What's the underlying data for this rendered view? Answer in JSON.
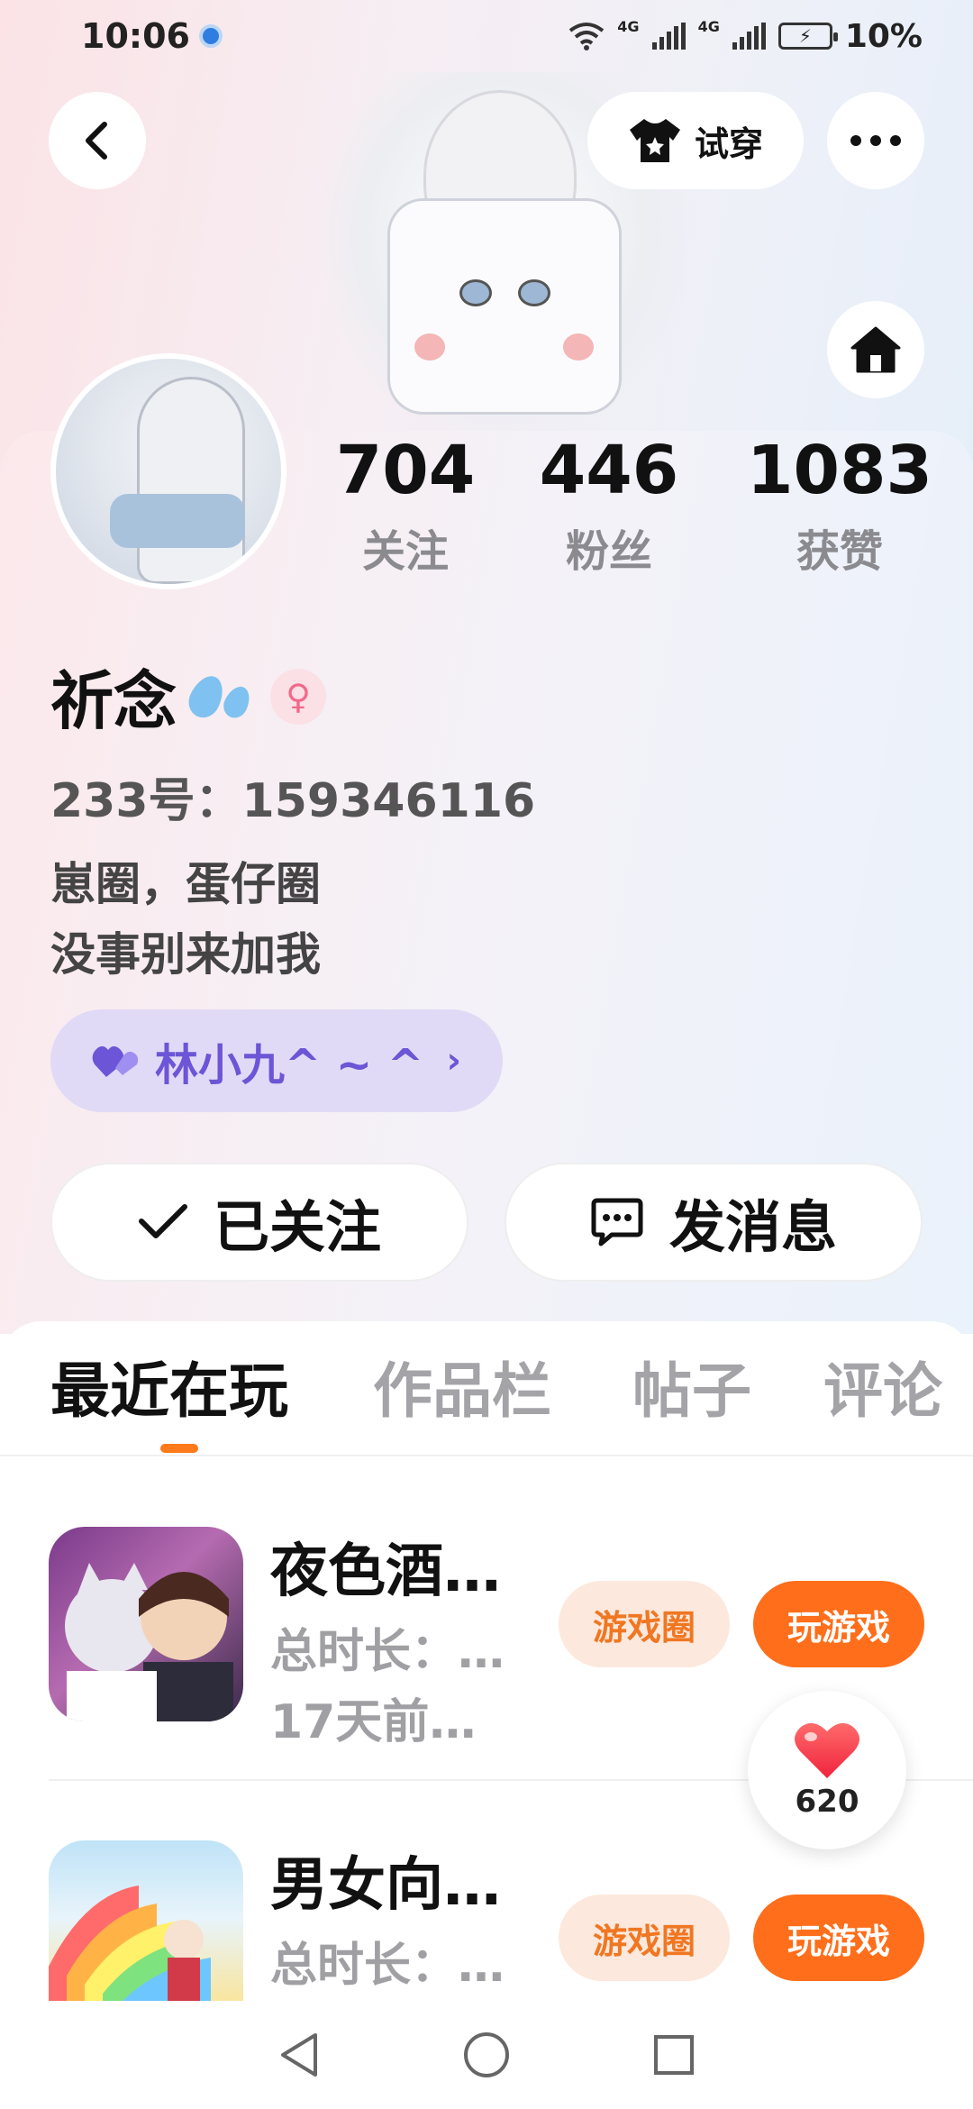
{
  "status_bar": {
    "time": "10:06",
    "network_left": "4G",
    "network_right": "4G",
    "battery": "10%"
  },
  "header": {
    "try_on_label": "试穿"
  },
  "profile": {
    "stats": [
      {
        "value": "704",
        "label": "关注"
      },
      {
        "value": "446",
        "label": "粉丝"
      },
      {
        "value": "1083",
        "label": "获赞"
      }
    ],
    "name": "祈念",
    "gender_symbol": "♀",
    "id_text": "233号：159346116",
    "bio_line1": "崽圈，蛋仔圈",
    "bio_line2": "没事别来加我",
    "friend_name": "林小九^ ~ ^",
    "follow_label": "已关注",
    "message_label": "发消息"
  },
  "tabs": [
    "最近在玩",
    "作品栏",
    "帖子",
    "评论"
  ],
  "games": [
    {
      "title": "夜色酒…",
      "duration": "总时长：…",
      "last_played": "17天前…",
      "circle_label": "游戏圈",
      "play_label": "玩游戏"
    },
    {
      "title": "男女向…",
      "duration": "总时长：…",
      "circle_label": "游戏圈",
      "play_label": "玩游戏"
    }
  ],
  "like_count": "620",
  "colors": {
    "accent_orange": "#ff6e1a",
    "friend_chip_bg": "#e1daf6",
    "friend_chip_text": "#6c55d6"
  }
}
